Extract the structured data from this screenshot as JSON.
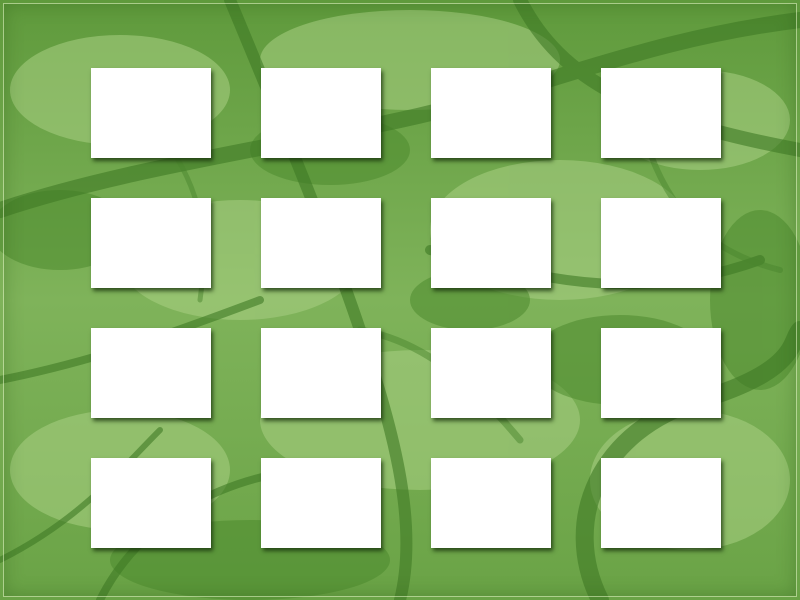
{
  "board": {
    "rows": 4,
    "columns": 4,
    "card_color": "#ffffff",
    "background_color": "#6fa64a",
    "cards": [
      {
        "row": 1,
        "col": 1,
        "state": "face-down"
      },
      {
        "row": 1,
        "col": 2,
        "state": "face-down"
      },
      {
        "row": 1,
        "col": 3,
        "state": "face-down"
      },
      {
        "row": 1,
        "col": 4,
        "state": "face-down"
      },
      {
        "row": 2,
        "col": 1,
        "state": "face-down"
      },
      {
        "row": 2,
        "col": 2,
        "state": "face-down"
      },
      {
        "row": 2,
        "col": 3,
        "state": "face-down"
      },
      {
        "row": 2,
        "col": 4,
        "state": "face-down"
      },
      {
        "row": 3,
        "col": 1,
        "state": "face-down"
      },
      {
        "row": 3,
        "col": 2,
        "state": "face-down"
      },
      {
        "row": 3,
        "col": 3,
        "state": "face-down"
      },
      {
        "row": 3,
        "col": 4,
        "state": "face-down"
      },
      {
        "row": 4,
        "col": 1,
        "state": "face-down"
      },
      {
        "row": 4,
        "col": 2,
        "state": "face-down"
      },
      {
        "row": 4,
        "col": 3,
        "state": "face-down"
      },
      {
        "row": 4,
        "col": 4,
        "state": "face-down"
      }
    ]
  }
}
